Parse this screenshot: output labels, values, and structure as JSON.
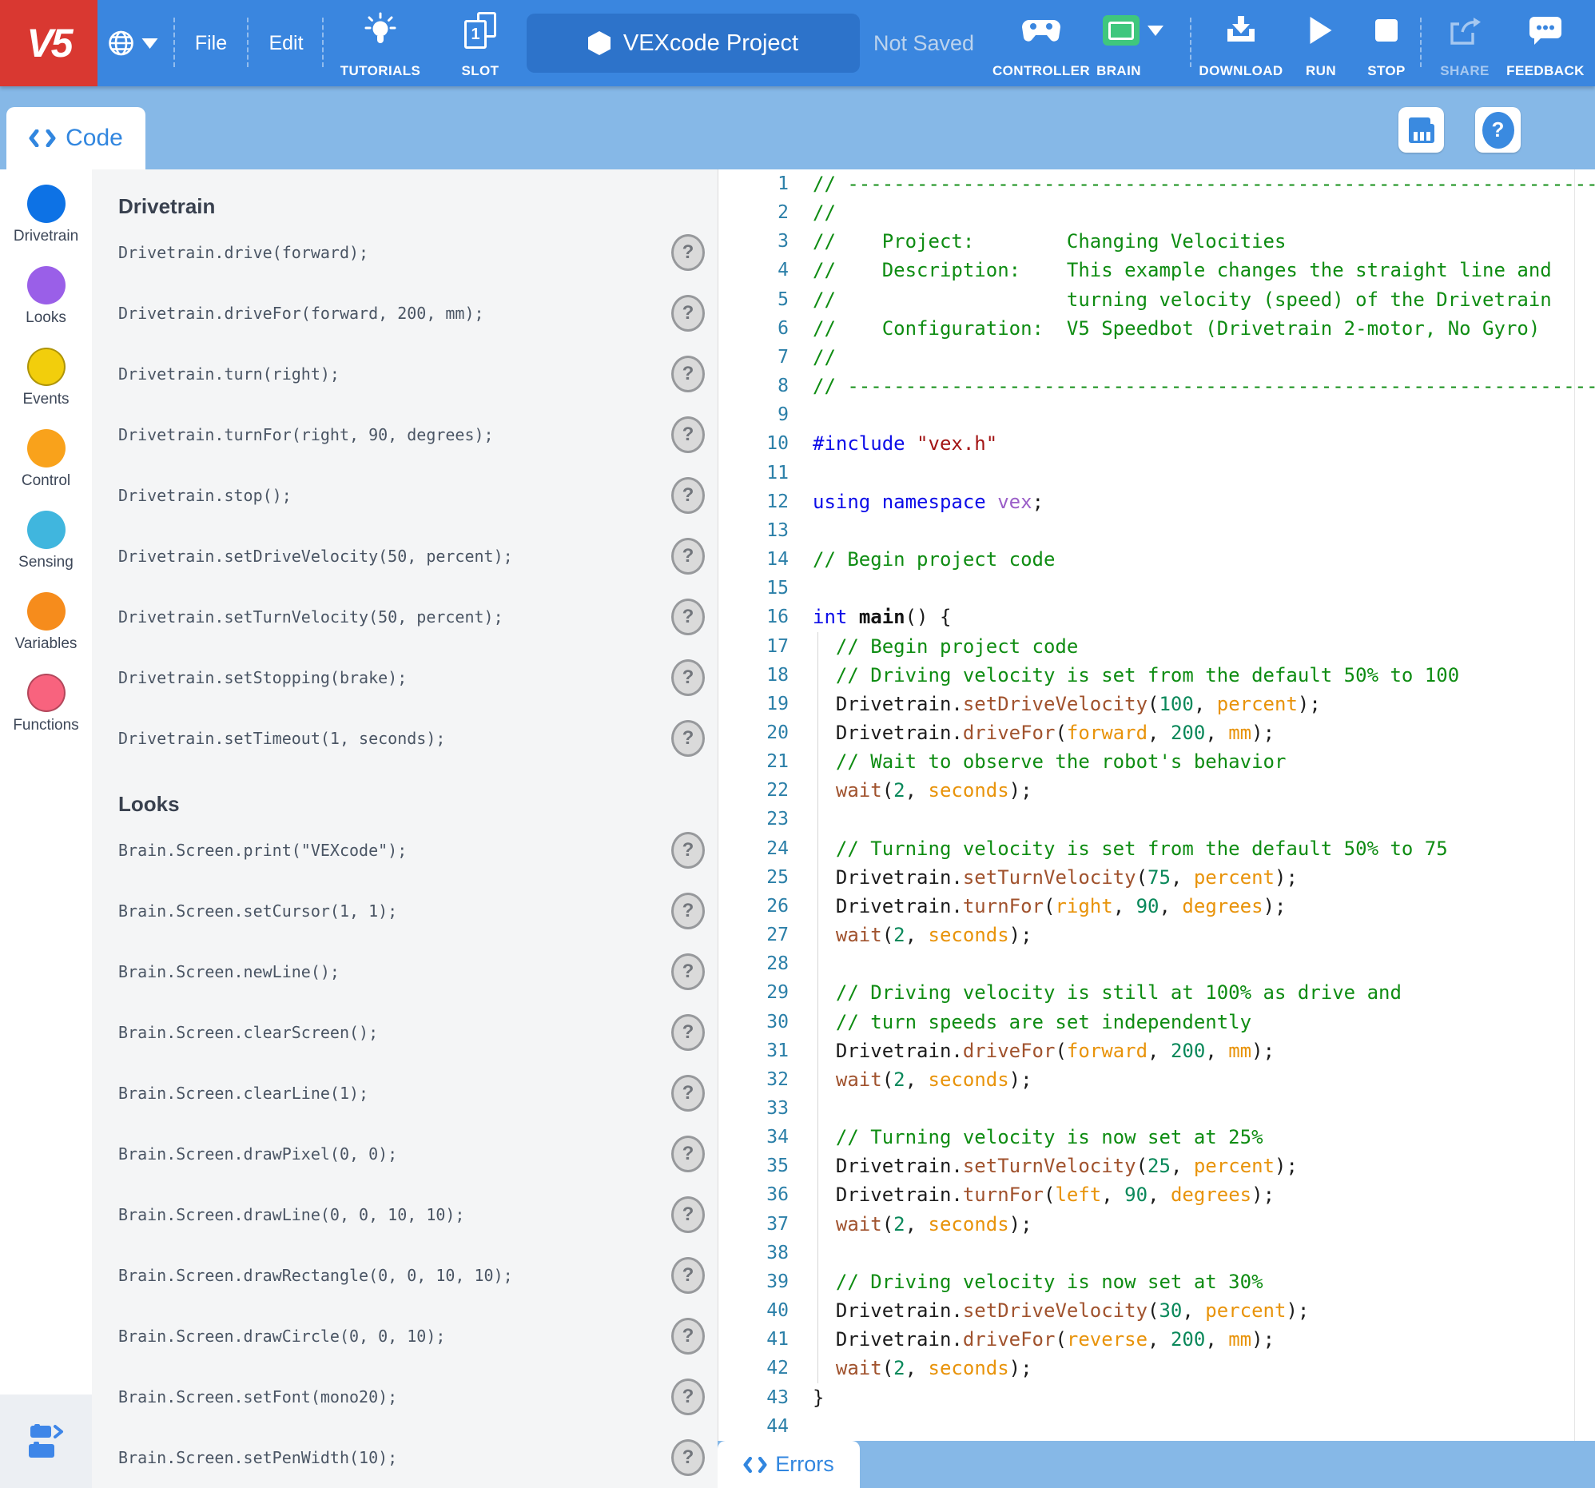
{
  "topbar": {
    "logo": "V5",
    "menu_file": "File",
    "menu_edit": "Edit",
    "tutorials": "TUTORIALS",
    "slot": "SLOT",
    "slot_number": "1",
    "project_name": "VEXcode Project",
    "save_status": "Not Saved",
    "controller": "CONTROLLER",
    "brain": "BRAIN",
    "download": "DOWNLOAD",
    "run": "RUN",
    "stop": "STOP",
    "share": "SHARE",
    "feedback": "FEEDBACK"
  },
  "subheader": {
    "tab": "Code",
    "help_glyph": "?"
  },
  "palette": {
    "categories": [
      {
        "label": "Drivetrain",
        "color": "#0D72E5",
        "bordered": false
      },
      {
        "label": "Looks",
        "color": "#9A5FE8",
        "bordered": false
      },
      {
        "label": "Events",
        "color": "#F2CE0C",
        "bordered": true
      },
      {
        "label": "Control",
        "color": "#F9A21B",
        "bordered": false
      },
      {
        "label": "Sensing",
        "color": "#40B6DE",
        "bordered": false
      },
      {
        "label": "Variables",
        "color": "#F68C1C",
        "bordered": false
      },
      {
        "label": "Functions",
        "color": "#F8637E",
        "bordered": true
      }
    ]
  },
  "commands": {
    "help_glyph": "?",
    "sections": [
      {
        "title": "Drivetrain",
        "items": [
          "Drivetrain.drive(forward);",
          "Drivetrain.driveFor(forward, 200, mm);",
          "Drivetrain.turn(right);",
          "Drivetrain.turnFor(right, 90, degrees);",
          "Drivetrain.stop();",
          "Drivetrain.setDriveVelocity(50, percent);",
          "Drivetrain.setTurnVelocity(50, percent);",
          "Drivetrain.setStopping(brake);",
          "Drivetrain.setTimeout(1, seconds);"
        ]
      },
      {
        "title": "Looks",
        "items": [
          "Brain.Screen.print(\"VEXcode\");",
          "Brain.Screen.setCursor(1, 1);",
          "Brain.Screen.newLine();",
          "Brain.Screen.clearScreen();",
          "Brain.Screen.clearLine(1);",
          "Brain.Screen.drawPixel(0, 0);",
          "Brain.Screen.drawLine(0, 0, 10, 10);",
          "Brain.Screen.drawRectangle(0, 0, 10, 10);",
          "Brain.Screen.drawCircle(0, 0, 10);",
          "Brain.Screen.setFont(mono20);",
          "Brain.Screen.setPenWidth(10);"
        ]
      }
    ]
  },
  "editor": {
    "lines": [
      {
        "g": false,
        "s": [
          [
            "comment",
            "// ------------------------------------------------------------------------"
          ]
        ]
      },
      {
        "g": false,
        "s": [
          [
            "comment",
            "//"
          ]
        ]
      },
      {
        "g": false,
        "s": [
          [
            "comment",
            "//    Project:        Changing Velocities"
          ]
        ]
      },
      {
        "g": false,
        "s": [
          [
            "comment",
            "//    Description:    This example changes the straight line and"
          ]
        ]
      },
      {
        "g": false,
        "s": [
          [
            "comment",
            "//                    turning velocity (speed) of the Drivetrain"
          ]
        ]
      },
      {
        "g": false,
        "s": [
          [
            "comment",
            "//    Configuration:  V5 Speedbot (Drivetrain 2-motor, No Gyro)"
          ]
        ]
      },
      {
        "g": false,
        "s": [
          [
            "comment",
            "//"
          ]
        ]
      },
      {
        "g": false,
        "s": [
          [
            "comment",
            "// ------------------------------------------------------------------------"
          ]
        ]
      },
      {
        "g": false,
        "s": []
      },
      {
        "g": false,
        "s": [
          [
            "keyword",
            "#include"
          ],
          [
            "plain",
            " "
          ],
          [
            "string",
            "\"vex.h\""
          ]
        ]
      },
      {
        "g": false,
        "s": []
      },
      {
        "g": false,
        "s": [
          [
            "keyword",
            "using namespace"
          ],
          [
            "plain",
            " "
          ],
          [
            "type",
            "vex"
          ],
          [
            "plain",
            ";"
          ]
        ]
      },
      {
        "g": false,
        "s": []
      },
      {
        "g": false,
        "s": [
          [
            "comment",
            "// Begin project code"
          ]
        ]
      },
      {
        "g": false,
        "s": []
      },
      {
        "g": false,
        "s": [
          [
            "keyword",
            "int"
          ],
          [
            "plain",
            " "
          ],
          [
            "fn",
            "main"
          ],
          [
            "plain",
            "() {"
          ]
        ]
      },
      {
        "g": true,
        "s": [
          [
            "comment",
            "  // Begin project code"
          ]
        ]
      },
      {
        "g": true,
        "s": [
          [
            "comment",
            "  // Driving velocity is set from the default 50% to 100"
          ]
        ]
      },
      {
        "g": true,
        "s": [
          [
            "plain",
            "  Drivetrain."
          ],
          [
            "method",
            "setDriveVelocity"
          ],
          [
            "plain",
            "("
          ],
          [
            "number",
            "100"
          ],
          [
            "plain",
            ", "
          ],
          [
            "enum",
            "percent"
          ],
          [
            "plain",
            ");"
          ]
        ]
      },
      {
        "g": true,
        "s": [
          [
            "plain",
            "  Drivetrain."
          ],
          [
            "method",
            "driveFor"
          ],
          [
            "plain",
            "("
          ],
          [
            "enum",
            "forward"
          ],
          [
            "plain",
            ", "
          ],
          [
            "number",
            "200"
          ],
          [
            "plain",
            ", "
          ],
          [
            "enum",
            "mm"
          ],
          [
            "plain",
            ");"
          ]
        ]
      },
      {
        "g": true,
        "s": [
          [
            "comment",
            "  // Wait to observe the robot's behavior"
          ]
        ]
      },
      {
        "g": true,
        "s": [
          [
            "plain",
            "  "
          ],
          [
            "method",
            "wait"
          ],
          [
            "plain",
            "("
          ],
          [
            "number",
            "2"
          ],
          [
            "plain",
            ", "
          ],
          [
            "enum",
            "seconds"
          ],
          [
            "plain",
            ");"
          ]
        ]
      },
      {
        "g": true,
        "s": []
      },
      {
        "g": true,
        "s": [
          [
            "comment",
            "  // Turning velocity is set from the default 50% to 75"
          ]
        ]
      },
      {
        "g": true,
        "s": [
          [
            "plain",
            "  Drivetrain."
          ],
          [
            "method",
            "setTurnVelocity"
          ],
          [
            "plain",
            "("
          ],
          [
            "number",
            "75"
          ],
          [
            "plain",
            ", "
          ],
          [
            "enum",
            "percent"
          ],
          [
            "plain",
            ");"
          ]
        ]
      },
      {
        "g": true,
        "s": [
          [
            "plain",
            "  Drivetrain."
          ],
          [
            "method",
            "turnFor"
          ],
          [
            "plain",
            "("
          ],
          [
            "enum",
            "right"
          ],
          [
            "plain",
            ", "
          ],
          [
            "number",
            "90"
          ],
          [
            "plain",
            ", "
          ],
          [
            "enum",
            "degrees"
          ],
          [
            "plain",
            ");"
          ]
        ]
      },
      {
        "g": true,
        "s": [
          [
            "plain",
            "  "
          ],
          [
            "method",
            "wait"
          ],
          [
            "plain",
            "("
          ],
          [
            "number",
            "2"
          ],
          [
            "plain",
            ", "
          ],
          [
            "enum",
            "seconds"
          ],
          [
            "plain",
            ");"
          ]
        ]
      },
      {
        "g": true,
        "s": []
      },
      {
        "g": true,
        "s": [
          [
            "comment",
            "  // Driving velocity is still at 100% as drive and"
          ]
        ]
      },
      {
        "g": true,
        "s": [
          [
            "comment",
            "  // turn speeds are set independently"
          ]
        ]
      },
      {
        "g": true,
        "s": [
          [
            "plain",
            "  Drivetrain."
          ],
          [
            "method",
            "driveFor"
          ],
          [
            "plain",
            "("
          ],
          [
            "enum",
            "forward"
          ],
          [
            "plain",
            ", "
          ],
          [
            "number",
            "200"
          ],
          [
            "plain",
            ", "
          ],
          [
            "enum",
            "mm"
          ],
          [
            "plain",
            ");"
          ]
        ]
      },
      {
        "g": true,
        "s": [
          [
            "plain",
            "  "
          ],
          [
            "method",
            "wait"
          ],
          [
            "plain",
            "("
          ],
          [
            "number",
            "2"
          ],
          [
            "plain",
            ", "
          ],
          [
            "enum",
            "seconds"
          ],
          [
            "plain",
            ");"
          ]
        ]
      },
      {
        "g": true,
        "s": []
      },
      {
        "g": true,
        "s": [
          [
            "comment",
            "  // Turning velocity is now set at 25%"
          ]
        ]
      },
      {
        "g": true,
        "s": [
          [
            "plain",
            "  Drivetrain."
          ],
          [
            "method",
            "setTurnVelocity"
          ],
          [
            "plain",
            "("
          ],
          [
            "number",
            "25"
          ],
          [
            "plain",
            ", "
          ],
          [
            "enum",
            "percent"
          ],
          [
            "plain",
            ");"
          ]
        ]
      },
      {
        "g": true,
        "s": [
          [
            "plain",
            "  Drivetrain."
          ],
          [
            "method",
            "turnFor"
          ],
          [
            "plain",
            "("
          ],
          [
            "enum",
            "left"
          ],
          [
            "plain",
            ", "
          ],
          [
            "number",
            "90"
          ],
          [
            "plain",
            ", "
          ],
          [
            "enum",
            "degrees"
          ],
          [
            "plain",
            ");"
          ]
        ]
      },
      {
        "g": true,
        "s": [
          [
            "plain",
            "  "
          ],
          [
            "method",
            "wait"
          ],
          [
            "plain",
            "("
          ],
          [
            "number",
            "2"
          ],
          [
            "plain",
            ", "
          ],
          [
            "enum",
            "seconds"
          ],
          [
            "plain",
            ");"
          ]
        ]
      },
      {
        "g": true,
        "s": []
      },
      {
        "g": true,
        "s": [
          [
            "comment",
            "  // Driving velocity is now set at 30%"
          ]
        ]
      },
      {
        "g": true,
        "s": [
          [
            "plain",
            "  Drivetrain."
          ],
          [
            "method",
            "setDriveVelocity"
          ],
          [
            "plain",
            "("
          ],
          [
            "number",
            "30"
          ],
          [
            "plain",
            ", "
          ],
          [
            "enum",
            "percent"
          ],
          [
            "plain",
            ");"
          ]
        ]
      },
      {
        "g": true,
        "s": [
          [
            "plain",
            "  Drivetrain."
          ],
          [
            "method",
            "driveFor"
          ],
          [
            "plain",
            "("
          ],
          [
            "enum",
            "reverse"
          ],
          [
            "plain",
            ", "
          ],
          [
            "number",
            "200"
          ],
          [
            "plain",
            ", "
          ],
          [
            "enum",
            "mm"
          ],
          [
            "plain",
            ");"
          ]
        ]
      },
      {
        "g": true,
        "s": [
          [
            "plain",
            "  "
          ],
          [
            "method",
            "wait"
          ],
          [
            "plain",
            "("
          ],
          [
            "number",
            "2"
          ],
          [
            "plain",
            ", "
          ],
          [
            "enum",
            "seconds"
          ],
          [
            "plain",
            ");"
          ]
        ]
      },
      {
        "g": false,
        "s": [
          [
            "plain",
            "}"
          ]
        ]
      },
      {
        "g": false,
        "s": []
      }
    ]
  },
  "errors": {
    "tab": "Errors"
  },
  "colors": {
    "topbar_blue": "#3A86DF",
    "logo_red": "#D93831",
    "subheader_blue": "#86B8E7",
    "pill_blue": "#2D73CA",
    "accent_blue": "#3186DF",
    "brain_green": "#3FC77D",
    "panel_gray": "#F4F5F6",
    "comment_green": "#0E8C12",
    "keyword_blue": "#0C0CE8",
    "string_red": "#A31515",
    "number_teal": "#09885A",
    "enum_orange": "#E8930A",
    "method_brown": "#A0522D",
    "type_purple": "#9B5FC8"
  }
}
